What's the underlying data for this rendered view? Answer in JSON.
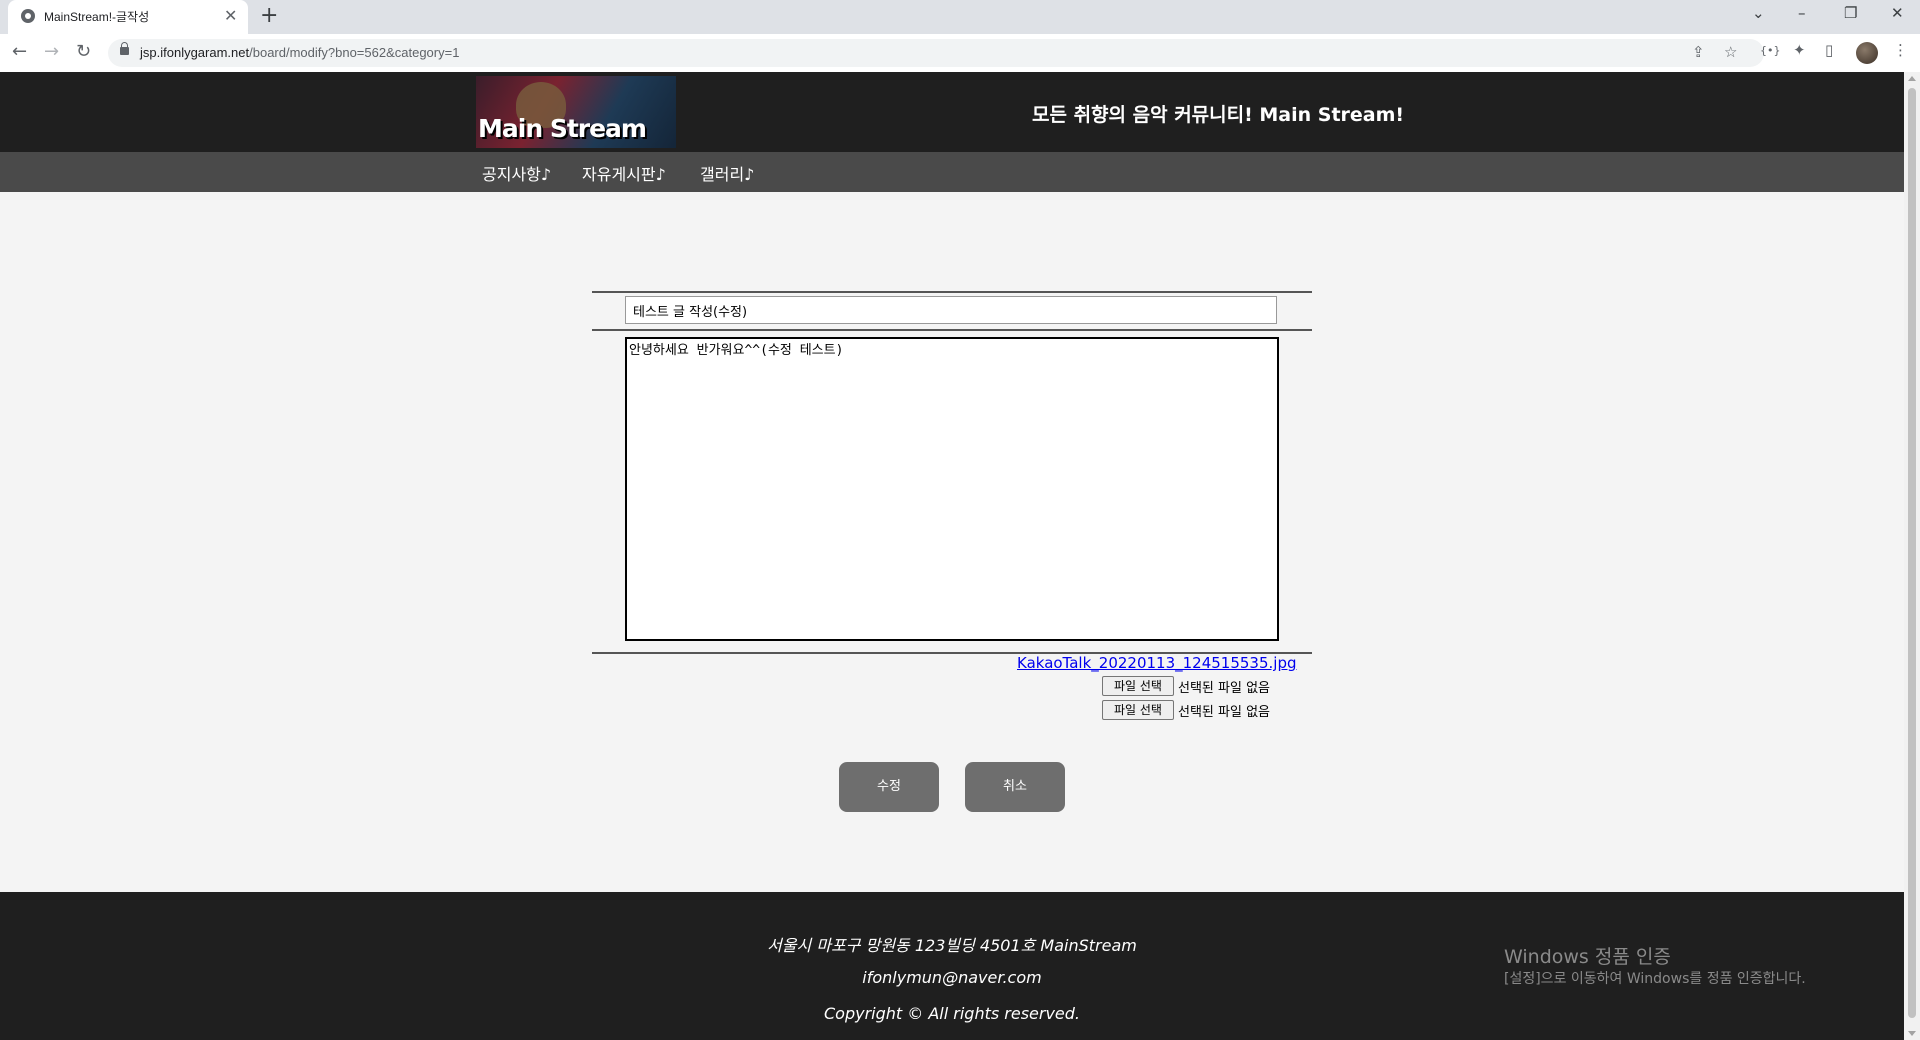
{
  "browser": {
    "tab_title": "MainStream!-글작성",
    "tab_close": "✕",
    "new_tab": "+",
    "url_host": "jsp.ifonlygaram.net",
    "url_path": "/board/modify?bno=562&category=1",
    "window_controls": [
      "⌄",
      "–",
      "❐",
      "✕"
    ]
  },
  "site": {
    "logo_text": "Main Stream",
    "tagline": "모든 취향의 음악 커뮤니티! Main Stream!",
    "nav": [
      "공지사항♪",
      "자유게시판♪",
      "갤러리♪"
    ]
  },
  "form": {
    "title_value": "테스트 글 작성(수정)",
    "content_value": "안녕하세요 반가워요^^(수정 테스트)",
    "attached_file": "KakaoTalk_20220113_124515535.jpg",
    "file_inputs": [
      {
        "button": "파일 선택",
        "status": "선택된 파일 없음"
      },
      {
        "button": "파일 선택",
        "status": "선택된 파일 없음"
      }
    ],
    "submit_label": "수정",
    "cancel_label": "취소"
  },
  "footer": {
    "address": "서울시 마포구 망원동 123빌딩 4501호 MainStream",
    "email": "ifonlymun@naver.com",
    "copyright": "Copyright © All rights reserved."
  },
  "watermark": {
    "title": "Windows 정품 인증",
    "subtitle": "[설정]으로 이동하여 Windows를 정품 인증합니다."
  }
}
